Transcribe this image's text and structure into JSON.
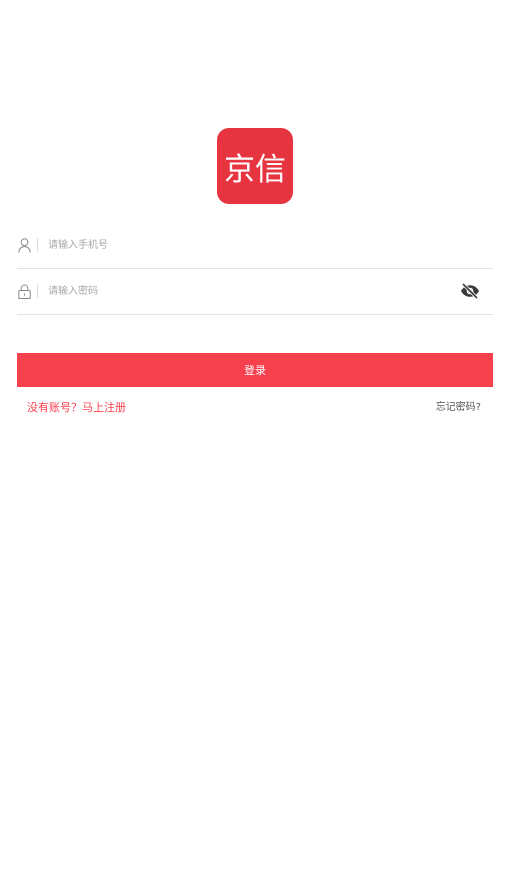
{
  "logo": {
    "text": "京信",
    "color": "#e63441"
  },
  "phone_field": {
    "icon": "user-icon",
    "placeholder": "请输入手机号",
    "value": ""
  },
  "password_field": {
    "icon": "lock-icon",
    "placeholder": "请输入密码",
    "value": "",
    "toggle_icon": "eye-off-icon"
  },
  "login_button": {
    "label": "登录",
    "color": "#f7404e"
  },
  "links": {
    "register": "没有账号？马上注册",
    "forgot": "忘记密码?"
  }
}
